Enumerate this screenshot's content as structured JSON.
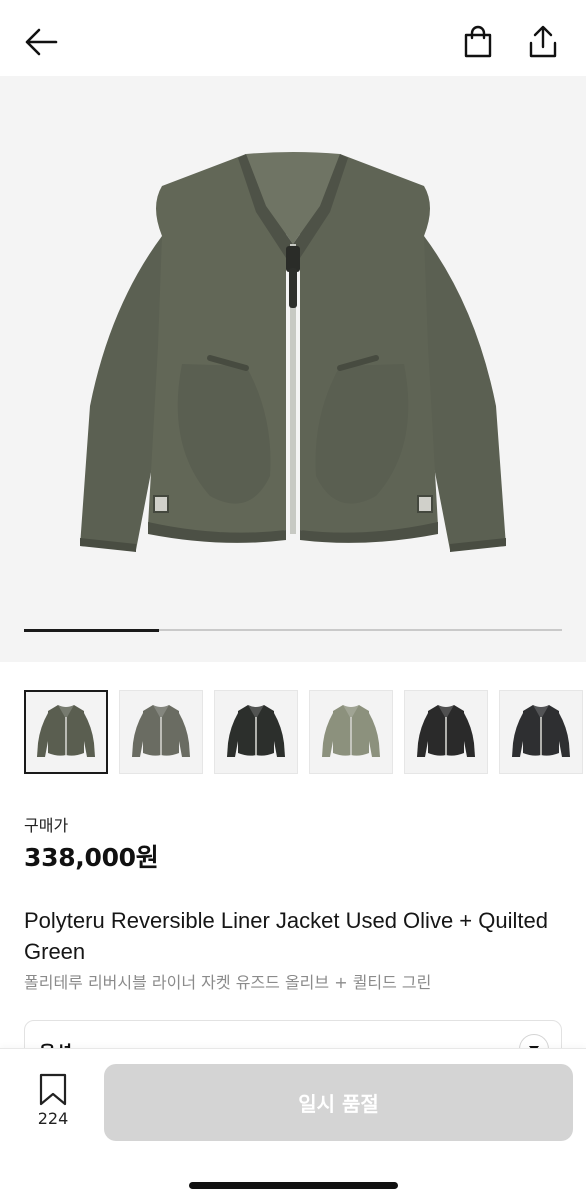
{
  "header": {
    "back_icon": "arrow-left-icon",
    "bag_icon": "shopping-bag-icon",
    "share_icon": "share-icon"
  },
  "hero": {
    "image": "olive-liner-jacket",
    "gallery_progress": 0.25
  },
  "thumbnails": [
    {
      "name": "olive-front",
      "color": "#5a5e50",
      "selected": true
    },
    {
      "name": "olive-front-2",
      "color": "#6a6c62",
      "selected": false
    },
    {
      "name": "black-front",
      "color": "#2c2f2c",
      "selected": false
    },
    {
      "name": "green-quilted-front",
      "color": "#8c917d",
      "selected": false
    },
    {
      "name": "black-quilted-front",
      "color": "#2a2a2a",
      "selected": false
    },
    {
      "name": "black-quilted-2",
      "color": "#2e2f31",
      "selected": false
    }
  ],
  "price": {
    "label": "구매가",
    "value": "338,000원"
  },
  "product": {
    "name_en": "Polyteru Reversible Liner Jacket Used Olive + Quilted Green",
    "name_ko": "폴리테루 리버시블 라이너 자켓 유즈드 올리브 + 퀼티드 그린"
  },
  "option": {
    "label": "옵션",
    "arrow_icon": "chevron-down-icon"
  },
  "bottom_bar": {
    "bookmark_icon": "bookmark-icon",
    "bookmark_count": "224",
    "cta_label": "일시 품절"
  },
  "colors": {
    "cta_disabled": "#d4d4d4",
    "hero_bg": "#f4f4f4",
    "jacket": "#5d6254"
  }
}
